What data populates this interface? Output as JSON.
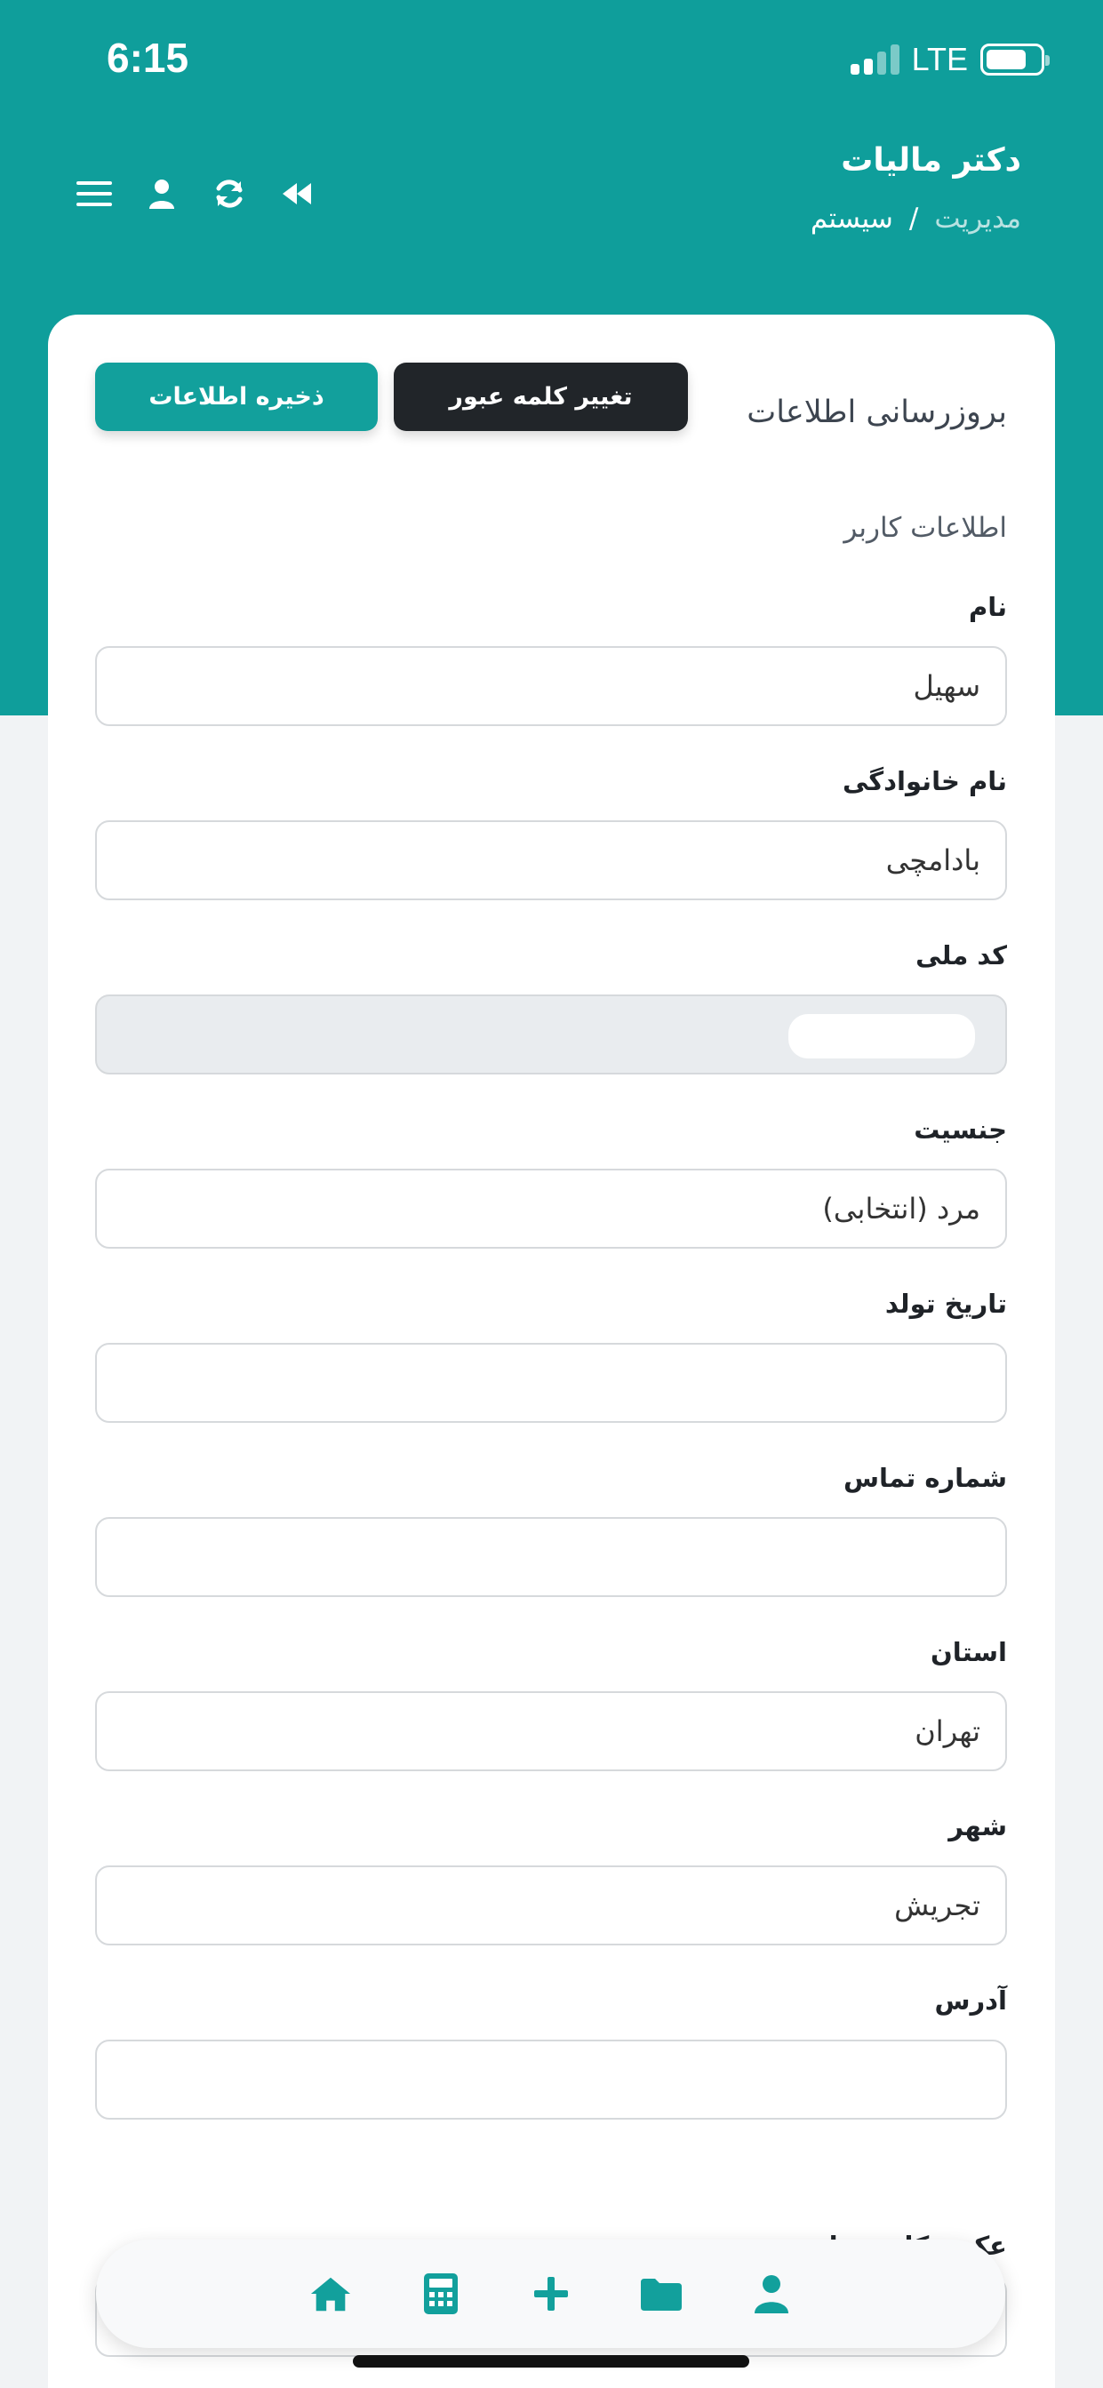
{
  "status_bar": {
    "time": "6:15",
    "network": "LTE"
  },
  "header": {
    "title": "دکتر مالیات",
    "breadcrumb": [
      "مدیریت",
      "/",
      "سیستم"
    ],
    "icons": [
      "menu-icon",
      "user-icon",
      "refresh-icon",
      "back-icon"
    ]
  },
  "card": {
    "title": "بروزرسانی اطلاعات",
    "buttons": {
      "change_password": "تغییر کلمه عبور",
      "save": "ذخیره اطلاعات"
    },
    "section_title": "اطلاعات کاربر",
    "fields": [
      {
        "label": "نام",
        "value": "سهیل",
        "placeholder": ""
      },
      {
        "label": "نام خانوادگی",
        "value": "بادامچی",
        "placeholder": ""
      },
      {
        "label": "کد ملی",
        "value": "",
        "placeholder": ""
      },
      {
        "label": "جنسیت",
        "value": "مرد (انتخابی)",
        "placeholder": ""
      },
      {
        "label": "تاریخ تولد",
        "value": "",
        "placeholder": ""
      },
      {
        "label": "شماره تماس",
        "value": "",
        "placeholder": ""
      },
      {
        "label": "استان",
        "value": "تهران",
        "placeholder": ""
      },
      {
        "label": "شهر",
        "value": "تجریش",
        "placeholder": ""
      },
      {
        "label": "آدرس",
        "value": "",
        "placeholder": ""
      }
    ],
    "partial_field_label": "عکس کارت ملی"
  },
  "bottom_nav": [
    "home-icon",
    "calculator-icon",
    "plus-icon",
    "folder-icon",
    "user-icon"
  ],
  "colors": {
    "primary": "#0f9e9b",
    "dark_button": "#212529",
    "background": "#f1f3f5"
  }
}
